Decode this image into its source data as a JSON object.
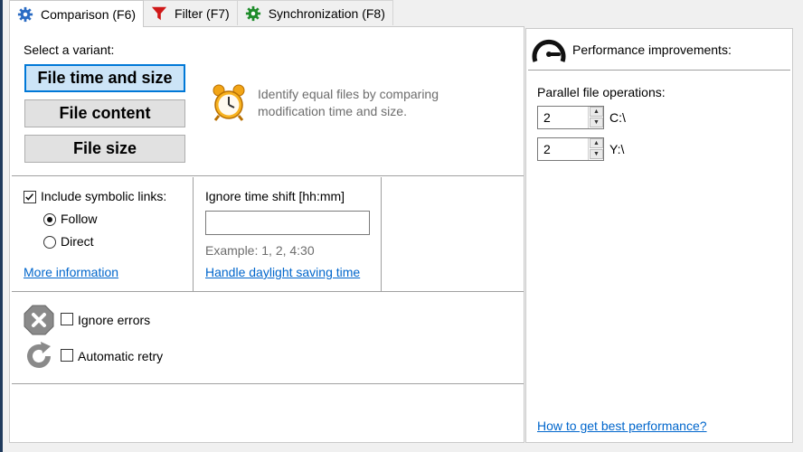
{
  "tabs": [
    {
      "label": "Comparison (F6)",
      "icon": "gear-icon",
      "active": true
    },
    {
      "label": "Filter (F7)",
      "icon": "funnel-icon",
      "active": false
    },
    {
      "label": "Synchronization (F8)",
      "icon": "sync-gear-icon",
      "active": false
    }
  ],
  "variant": {
    "heading": "Select a variant:",
    "options": [
      "File time and size",
      "File content",
      "File size"
    ],
    "selected": "File time and size",
    "description_line1": "Identify equal files by comparing",
    "description_line2": "modification time and size."
  },
  "symlinks": {
    "label": "Include symbolic links:",
    "checked": true,
    "follow_label": "Follow",
    "direct_label": "Direct",
    "selected": "Follow",
    "more_info_link": "More information"
  },
  "time_shift": {
    "label": "Ignore time shift [hh:mm]",
    "value": "",
    "example": "Example:  1, 2, 4:30",
    "dst_link": "Handle daylight saving time"
  },
  "errors": {
    "ignore_label": "Ignore errors",
    "ignore_checked": false,
    "retry_label": "Automatic retry",
    "retry_checked": false
  },
  "performance": {
    "title": "Performance improvements:",
    "parallel_label": "Parallel file operations:",
    "devices": [
      {
        "value": "2",
        "label": "C:\\"
      },
      {
        "value": "2",
        "label": "Y:\\"
      }
    ],
    "best_link": "How to get best performance?"
  },
  "colors": {
    "accent": "#0078d7",
    "link": "#0066cc",
    "selected_bg": "#cce4f7"
  }
}
